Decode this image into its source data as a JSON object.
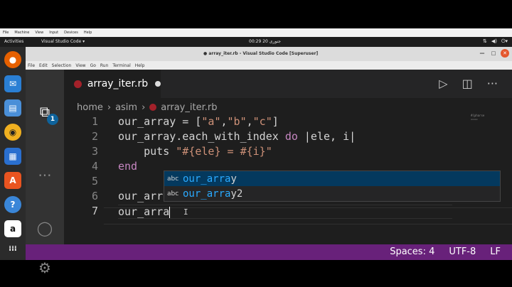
{
  "vm_menu": [
    "File",
    "Machine",
    "View",
    "Input",
    "Devices",
    "Help"
  ],
  "topbar": {
    "activities": "Activities",
    "app_menu": "Visual Studio Code ▾",
    "clock": "00:29  20 جنوری",
    "tray_icons": [
      "network-icon",
      "volume-icon",
      "power-icon"
    ]
  },
  "dock": {
    "items": [
      {
        "name": "firefox-icon",
        "color": "#e66000",
        "glyph": "●"
      },
      {
        "name": "thunderbird-icon",
        "color": "#2a7fd4",
        "glyph": "✉"
      },
      {
        "name": "files-icon",
        "color": "#4a8fd8",
        "glyph": "▤"
      },
      {
        "name": "rhythmbox-icon",
        "color": "#f0b020",
        "glyph": "◉"
      },
      {
        "name": "writer-icon",
        "color": "#2a6fcf",
        "glyph": "▦"
      },
      {
        "name": "software-icon",
        "color": "#e95420",
        "glyph": "A"
      },
      {
        "name": "help-icon",
        "color": "#3a86d8",
        "glyph": "?"
      },
      {
        "name": "amazon-icon",
        "color": "#ffffff",
        "glyph": "a"
      },
      {
        "name": "show-apps-icon",
        "color": "#2b2b2b",
        "glyph": "⁞⁞⁞"
      }
    ]
  },
  "window": {
    "title": "● array_iter.rb - Visual Studio Code [Superuser]",
    "menu": [
      "File",
      "Edit",
      "Selection",
      "View",
      "Go",
      "Run",
      "Terminal",
      "Help"
    ]
  },
  "tab": {
    "name": "array_iter.rb"
  },
  "breadcrumb": {
    "parts": [
      "home",
      "asim",
      "array_iter.rb"
    ]
  },
  "editor": {
    "line_numbers": [
      "1",
      "2",
      "3",
      "4",
      "5",
      "6",
      "7"
    ],
    "lines": {
      "l1": {
        "a": "our_array = [",
        "s1": "\"a\"",
        "c1": ",",
        "s2": "\"b\"",
        "c2": ",",
        "s3": "\"c\"",
        "end": "]"
      },
      "l2": {
        "a": "our_array.each_with_index ",
        "kw": "do",
        "b": " |ele, i|"
      },
      "l3": {
        "indent": "    puts ",
        "s": "\"#{ele} = #{i}\""
      },
      "l4": {
        "kw": "end"
      },
      "l6": {
        "text": "our_arr"
      },
      "l7": {
        "text": "our_arra"
      }
    }
  },
  "minimap": [
    "#{pharse",
    "===="
  ],
  "suggest": {
    "items": [
      {
        "icon_label": "abc",
        "match": "our_arra",
        "rest": "y"
      },
      {
        "icon_label": "abc",
        "match": "our_arra",
        "rest": "y2"
      }
    ]
  },
  "statusbar": {
    "spaces": "Spaces: 4",
    "encoding": "UTF-8",
    "eol": "LF"
  },
  "colors": {
    "statusbar": "#68217a",
    "editor_bg": "#1e1e1e",
    "string": "#ce9178",
    "keyword": "#c586c0",
    "suggest_highlight": "#2aaaff"
  }
}
